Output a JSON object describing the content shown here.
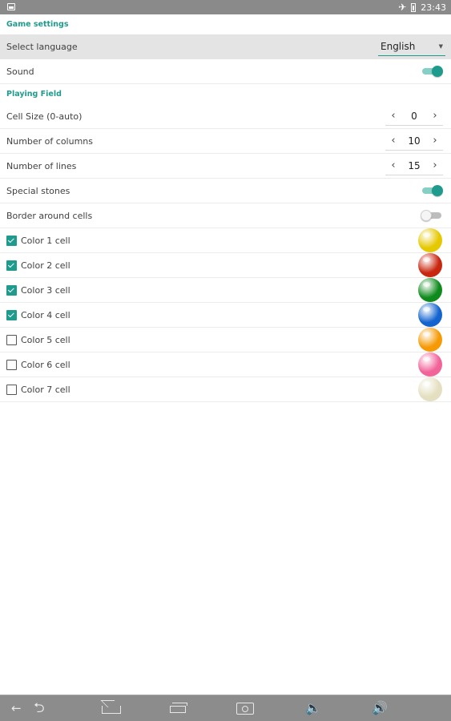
{
  "status_bar": {
    "time": "23:43"
  },
  "game_settings": {
    "header": "Game settings",
    "language": {
      "label": "Select language",
      "value": "English"
    },
    "sound": {
      "label": "Sound",
      "enabled": true
    }
  },
  "playing_field": {
    "header": "Playing Field",
    "cell_size": {
      "label": "Cell Size (0-auto)",
      "value": "0"
    },
    "columns": {
      "label": "Number of columns",
      "value": "10"
    },
    "lines": {
      "label": "Number of lines",
      "value": "15"
    },
    "special_stones": {
      "label": "Special stones",
      "enabled": true
    },
    "border_cells": {
      "label": "Border around cells",
      "enabled": false
    },
    "colors": [
      {
        "label": "Color 1 cell",
        "checked": true,
        "color": "#e6c800"
      },
      {
        "label": "Color 2 cell",
        "checked": true,
        "color": "#c9260f"
      },
      {
        "label": "Color 3 cell",
        "checked": true,
        "color": "#0f8a1c"
      },
      {
        "label": "Color 4 cell",
        "checked": true,
        "color": "#1464cf"
      },
      {
        "label": "Color 5 cell",
        "checked": false,
        "color": "#f59a05"
      },
      {
        "label": "Color 6 cell",
        "checked": false,
        "color": "#f2639a"
      },
      {
        "label": "Color 7 cell",
        "checked": false,
        "color": "#e4dfc0"
      }
    ]
  },
  "icons": {
    "prev": "‹",
    "next": "›",
    "caret": "▼",
    "plane": "✈"
  },
  "nav": {
    "items": [
      "back-arrow-icon",
      "back-icon",
      "home-icon",
      "recent-apps-icon",
      "screenshot-icon",
      "volume-down-icon",
      "volume-up-icon"
    ]
  }
}
